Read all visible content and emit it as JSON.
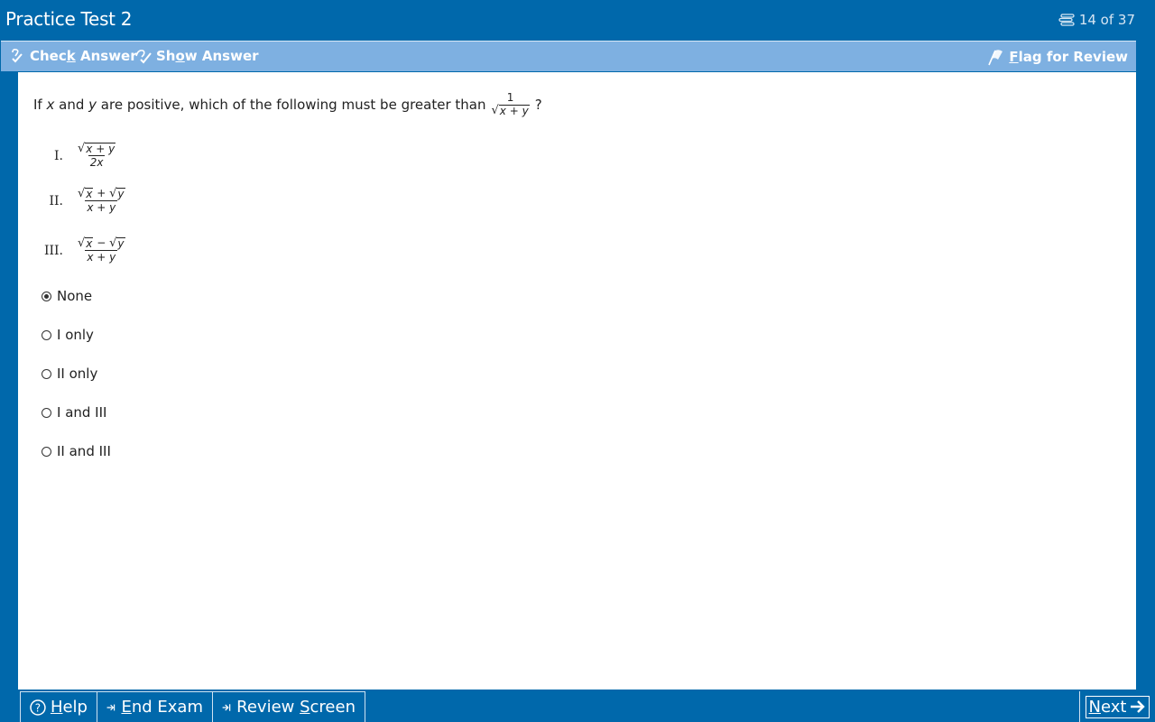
{
  "window": {
    "title": "Practice Test 2",
    "counter": "14 of 37"
  },
  "toolbar": {
    "check_prefix": "Chec",
    "check_underline": "k",
    "check_suffix": " Answer",
    "show_prefix": "Sh",
    "show_underline": "o",
    "show_suffix": "w Answer",
    "flag_underline": "F",
    "flag_suffix": "lag for Review"
  },
  "question": {
    "intro_1": "If ",
    "var_x": "x",
    "and": " and ",
    "var_y": "y",
    "intro_2": " are positive, which of the following must be greater than",
    "frac_num": "1",
    "frac_den": "x + y",
    "end": "?"
  },
  "statements": [
    {
      "roman": "I.",
      "num": "x + y",
      "den": "2x"
    },
    {
      "roman": "II.",
      "num_a": "x",
      "op": "+",
      "num_b": "y",
      "den": "x + y"
    },
    {
      "roman": "III.",
      "num_a": "x",
      "op": "−",
      "num_b": "y",
      "den": "x + y"
    }
  ],
  "choices": [
    {
      "label": "None",
      "selected": true
    },
    {
      "label": "I only",
      "selected": false
    },
    {
      "label": "II only",
      "selected": false
    },
    {
      "label": "I and III",
      "selected": false
    },
    {
      "label": "II and III",
      "selected": false
    }
  ],
  "bottom": {
    "help_underline": "H",
    "help_suffix": "elp",
    "end_underline": "E",
    "end_suffix": "nd Exam",
    "review_prefix": "Review ",
    "review_underline": "S",
    "review_suffix": "creen",
    "next_underline": "N",
    "next_suffix": "ext"
  }
}
